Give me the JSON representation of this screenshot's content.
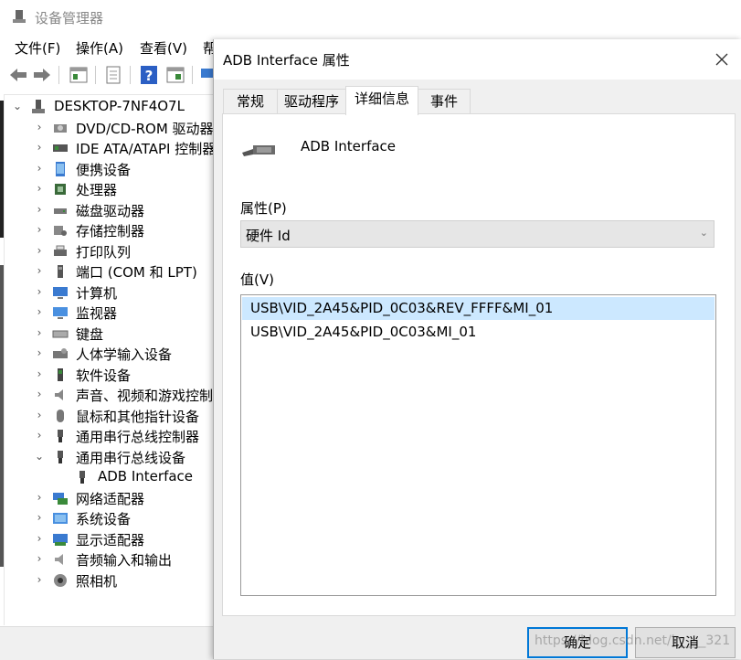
{
  "device_manager": {
    "title": "设备管理器",
    "menu": [
      "文件(F)",
      "操作(A)",
      "查看(V)",
      "帮"
    ],
    "tree": {
      "root": "DESKTOP-7NF4O7L",
      "items": [
        {
          "label": "DVD/CD-ROM 驱动器",
          "icon": "disc-drive-icon"
        },
        {
          "label": "IDE ATA/ATAPI 控制器",
          "icon": "ide-controller-icon"
        },
        {
          "label": "便携设备",
          "icon": "portable-device-icon"
        },
        {
          "label": "处理器",
          "icon": "processor-icon"
        },
        {
          "label": "磁盘驱动器",
          "icon": "disk-drive-icon"
        },
        {
          "label": "存储控制器",
          "icon": "storage-controller-icon"
        },
        {
          "label": "打印队列",
          "icon": "printer-icon"
        },
        {
          "label": "端口 (COM 和 LPT)",
          "icon": "port-icon"
        },
        {
          "label": "计算机",
          "icon": "computer-icon"
        },
        {
          "label": "监视器",
          "icon": "monitor-icon"
        },
        {
          "label": "键盘",
          "icon": "keyboard-icon"
        },
        {
          "label": "人体学输入设备",
          "icon": "hid-icon"
        },
        {
          "label": "软件设备",
          "icon": "software-device-icon"
        },
        {
          "label": "声音、视频和游戏控制器",
          "icon": "speaker-icon"
        },
        {
          "label": "鼠标和其他指针设备",
          "icon": "mouse-icon"
        },
        {
          "label": "通用串行总线控制器",
          "icon": "usb-icon"
        },
        {
          "label": "通用串行总线设备",
          "icon": "usb-icon",
          "expanded": true
        },
        {
          "label": "ADB Interface",
          "icon": "usb-plug-icon",
          "child": true
        },
        {
          "label": "网络适配器",
          "icon": "network-adapter-icon"
        },
        {
          "label": "系统设备",
          "icon": "system-device-icon"
        },
        {
          "label": "显示适配器",
          "icon": "display-adapter-icon"
        },
        {
          "label": "音频输入和输出",
          "icon": "audio-icon"
        },
        {
          "label": "照相机",
          "icon": "camera-icon"
        }
      ]
    }
  },
  "dialog": {
    "title": "ADB Interface 属性",
    "tabs": [
      {
        "label": "常规"
      },
      {
        "label": "驱动程序"
      },
      {
        "label": "详细信息",
        "active": true
      },
      {
        "label": "事件"
      }
    ],
    "device_name": "ADB Interface",
    "property_label": "属性(P)",
    "property_selected": "硬件 Id",
    "value_label": "值(V)",
    "values": [
      "USB\\VID_2A45&PID_0C03&REV_FFFF&MI_01",
      "USB\\VID_2A45&PID_0C03&MI_01"
    ],
    "ok_label": "确定",
    "cancel_label": "取消"
  },
  "watermark": "https://blog.csdn.net/lr____321"
}
